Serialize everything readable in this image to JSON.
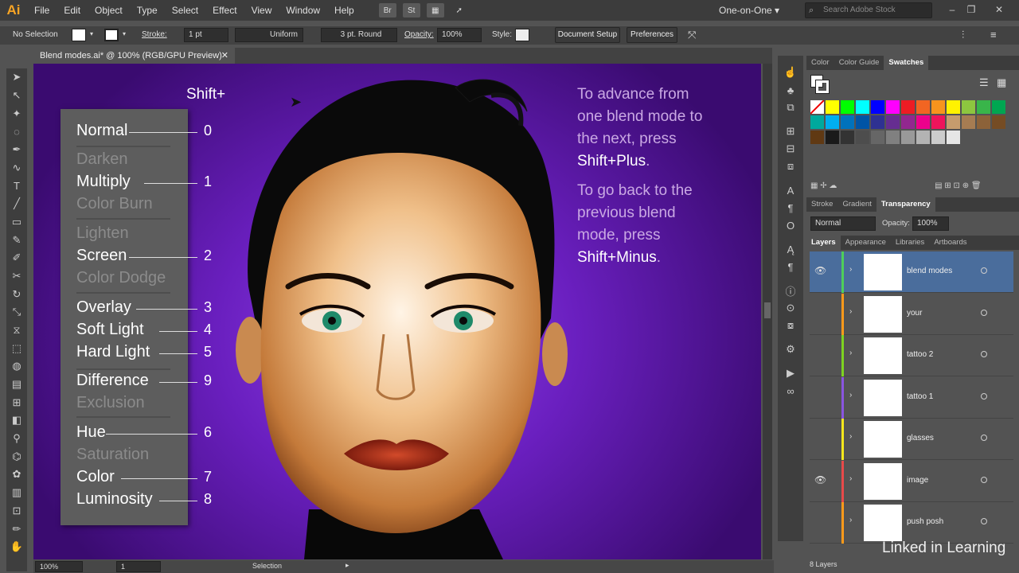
{
  "menubar": {
    "logo": "Ai",
    "items": [
      "File",
      "Edit",
      "Object",
      "Type",
      "Select",
      "Effect",
      "View",
      "Window",
      "Help"
    ],
    "bridge_btn": "Br",
    "stock_btn": "St",
    "workspace": "One-on-One",
    "search_placeholder": "Search Adobe Stock"
  },
  "control": {
    "selection": "No Selection",
    "stroke_label": "Stroke:",
    "stroke_value": "1 pt",
    "profile": "Uniform",
    "brush": "3 pt. Round",
    "opacity_label": "Opacity:",
    "opacity_value": "100%",
    "style_label": "Style:",
    "doc_setup": "Document Setup",
    "preferences": "Preferences"
  },
  "document": {
    "tab_title": "Blend modes.ai* @ 100% (RGB/GPU Preview)"
  },
  "artwork": {
    "shift_label": "Shift+",
    "modes": [
      {
        "name": "Normal",
        "key": "0",
        "on": true
      },
      {
        "name": "Darken",
        "key": "",
        "on": false
      },
      {
        "name": "Multiply",
        "key": "1",
        "on": true
      },
      {
        "name": "Color Burn",
        "key": "",
        "on": false
      },
      {
        "name": "Lighten",
        "key": "",
        "on": false
      },
      {
        "name": "Screen",
        "key": "2",
        "on": true
      },
      {
        "name": "Color Dodge",
        "key": "",
        "on": false
      },
      {
        "name": "Overlay",
        "key": "3",
        "on": true
      },
      {
        "name": "Soft Light",
        "key": "4",
        "on": true
      },
      {
        "name": "Hard Light",
        "key": "5",
        "on": true
      },
      {
        "name": "Difference",
        "key": "9",
        "on": true
      },
      {
        "name": "Exclusion",
        "key": "",
        "on": false
      },
      {
        "name": "Hue",
        "key": "6",
        "on": true
      },
      {
        "name": "Saturation",
        "key": "",
        "on": false
      },
      {
        "name": "Color",
        "key": "7",
        "on": true
      },
      {
        "name": "Luminosity",
        "key": "8",
        "on": true
      }
    ],
    "instr1_lines": [
      "To advance from",
      "one blend mode to",
      "the next, press"
    ],
    "instr1_key": "Shift+Plus",
    "instr2_lines": [
      "To go back to the",
      "previous blend",
      "mode, press"
    ],
    "instr2_key": "Shift+Minus",
    "period": "."
  },
  "status": {
    "zoom": "100%",
    "artboard": "1",
    "tool": "Selection"
  },
  "panels": {
    "color_tabs": [
      "Color",
      "Color Guide",
      "Swatches"
    ],
    "transp_tabs": [
      "Stroke",
      "Gradient",
      "Transparency"
    ],
    "blend_mode": "Normal",
    "opacity_label": "Opacity:",
    "opacity_value": "100%",
    "layer_tabs": [
      "Layers",
      "Appearance",
      "Libraries",
      "Artboards"
    ],
    "layers": [
      {
        "name": "blend modes",
        "color": "#4fcf5a",
        "visible": true,
        "selected": true
      },
      {
        "name": "your",
        "color": "#ff9a1a",
        "visible": false,
        "selected": false
      },
      {
        "name": "tattoo 2",
        "color": "#7ed321",
        "visible": false,
        "selected": false
      },
      {
        "name": "tattoo 1",
        "color": "#8a55e0",
        "visible": false,
        "selected": false
      },
      {
        "name": "glasses",
        "color": "#f6e71c",
        "visible": false,
        "selected": false
      },
      {
        "name": "image",
        "color": "#e84a4a",
        "visible": true,
        "selected": false
      },
      {
        "name": "push posh",
        "color": "#ff9a1a",
        "visible": false,
        "selected": false
      }
    ],
    "layers_count": "8 Layers"
  },
  "watermark": "Linked in Learning",
  "colors": {
    "swatches": [
      "#ff0000",
      "#ffff00",
      "#00ff00",
      "#00ffff",
      "#0000ff",
      "#ff00ff",
      "#ed1c24",
      "#f26522",
      "#f7941d",
      "#fff200",
      "#8dc63f",
      "#39b54a",
      "#00a651",
      "#00a99d",
      "#00aeef",
      "#0072bc",
      "#0054a6",
      "#2e3192",
      "#662d91",
      "#92278f",
      "#ec008c",
      "#ed145b",
      "#c69c6d",
      "#a67c52",
      "#8c6239",
      "#754c24",
      "#603913",
      "#1a1a1a",
      "#333333",
      "#4d4d4d",
      "#666666",
      "#808080",
      "#999999",
      "#b3b3b3",
      "#cccccc",
      "#e6e6e6"
    ]
  }
}
